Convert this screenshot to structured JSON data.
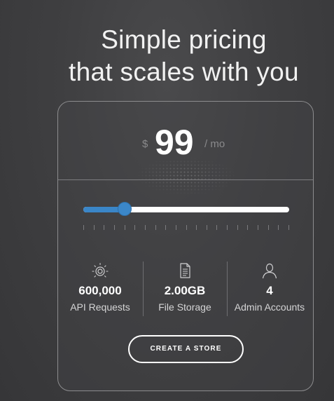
{
  "headline": {
    "line1": "Simple pricing",
    "line2": "that scales with you"
  },
  "pricing": {
    "currency": "$",
    "amount": "99",
    "period": "/ mo"
  },
  "slider": {
    "level_fraction": 0.2,
    "fill_color": "#3a86c8",
    "track_color": "#ffffff",
    "tick_count": 21
  },
  "features": [
    {
      "icon": "api-gauge-icon",
      "value": "600,000",
      "label": "API Requests"
    },
    {
      "icon": "document-icon",
      "value": "2.00GB",
      "label": "File Storage"
    },
    {
      "icon": "user-icon",
      "value": "4",
      "label": "Admin Accounts"
    }
  ],
  "cta": {
    "label": "CREATE A STORE"
  }
}
